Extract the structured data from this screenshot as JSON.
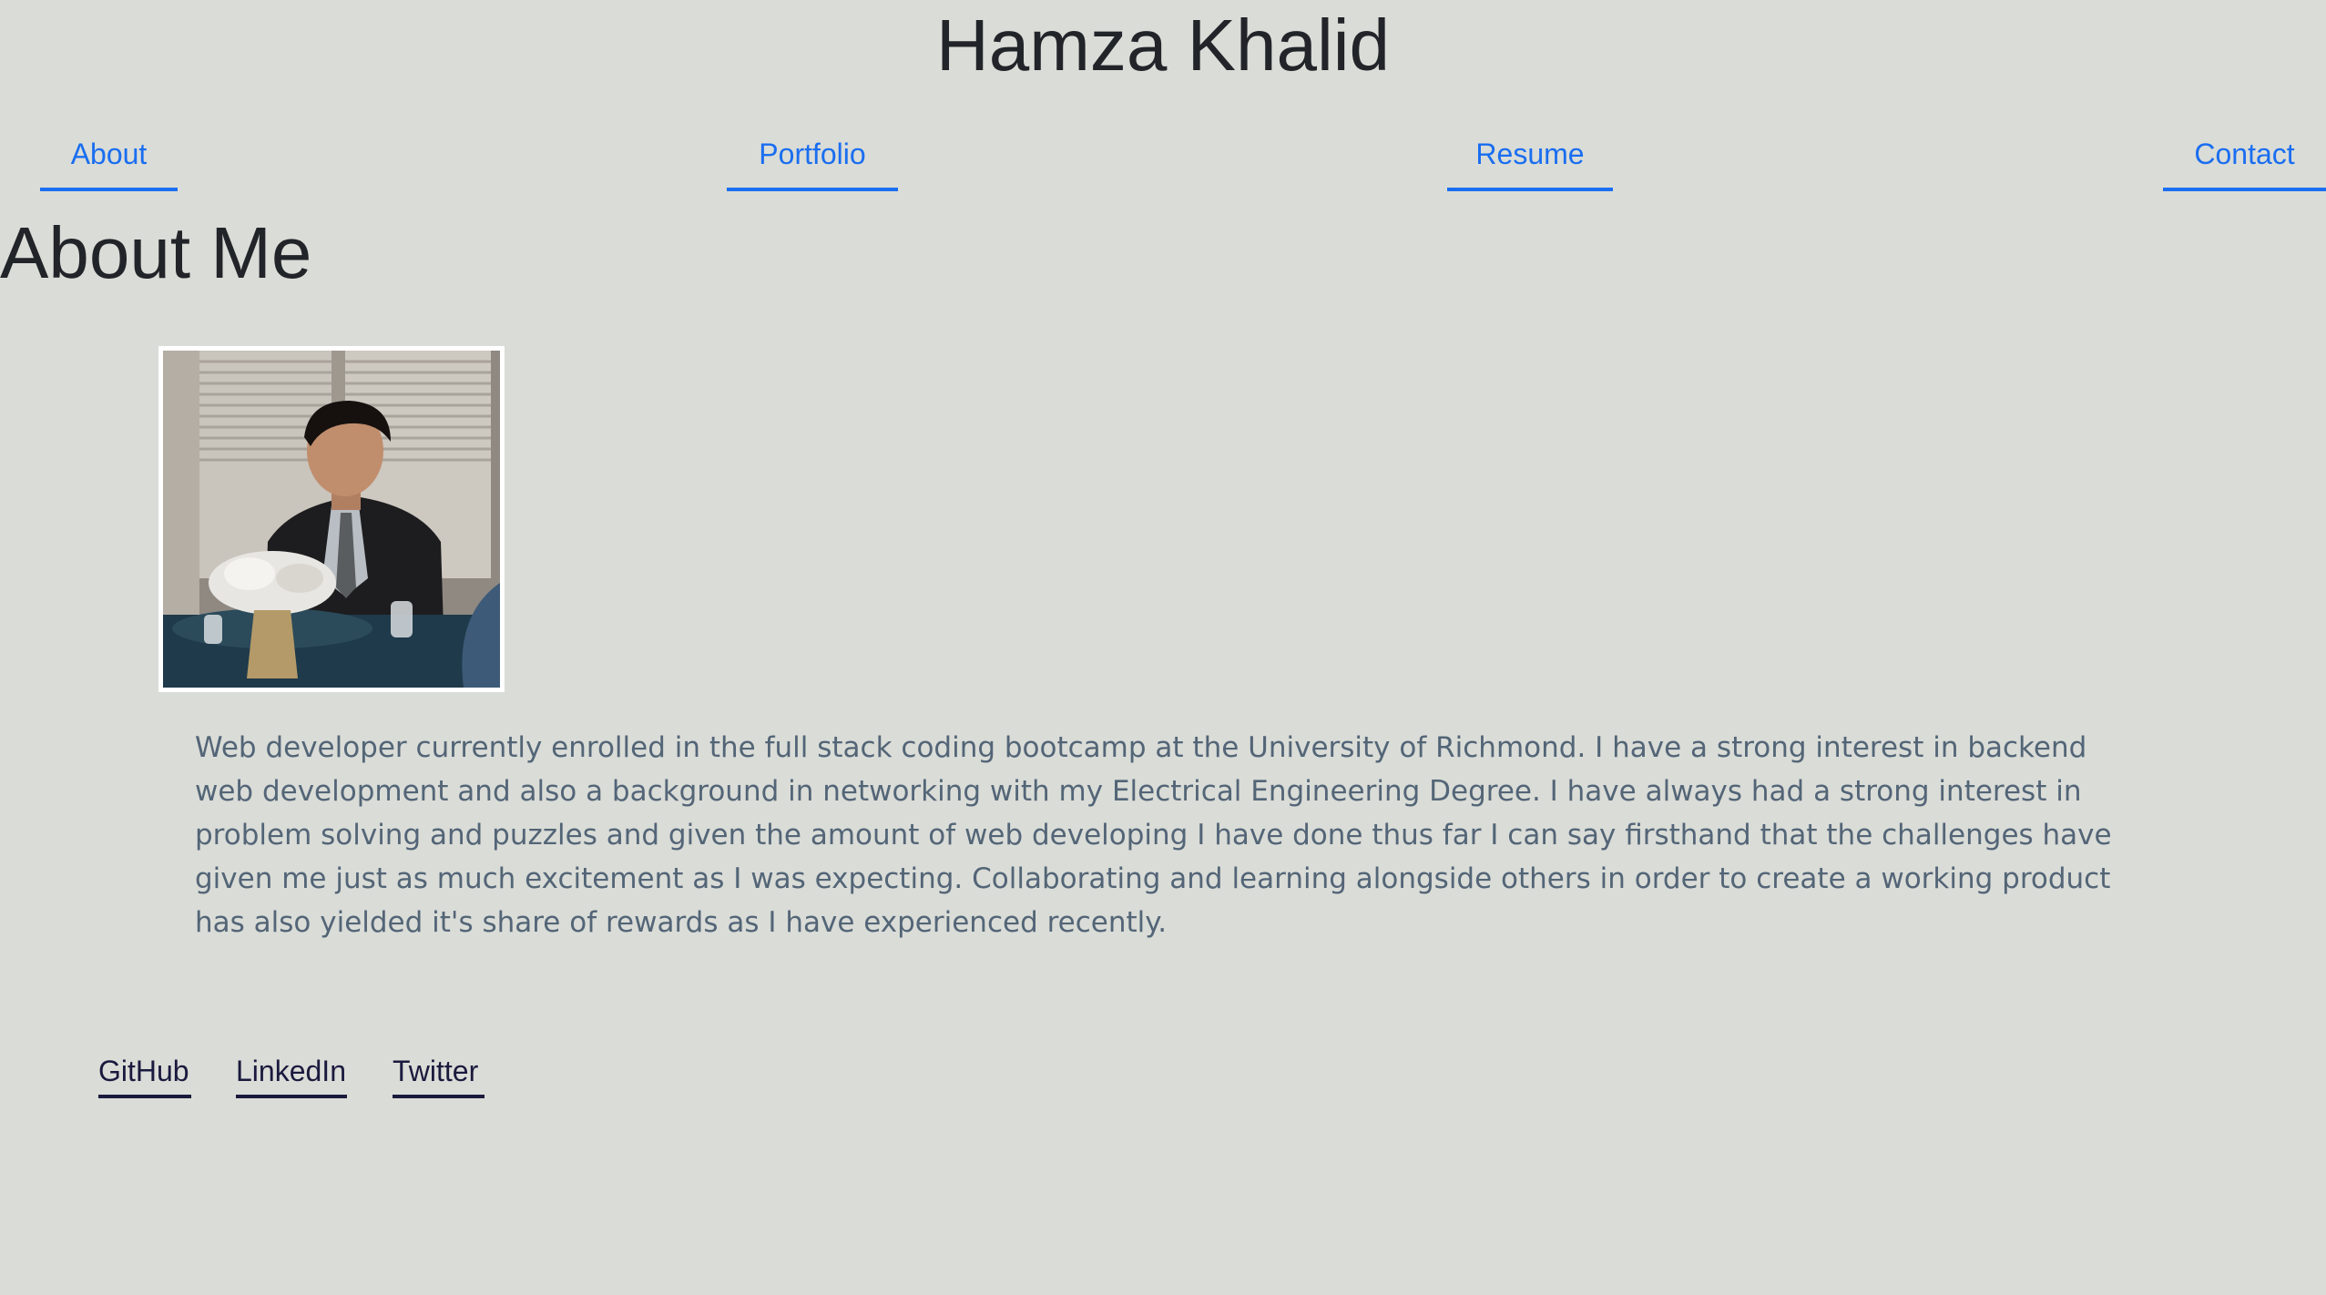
{
  "header": {
    "title": "Hamza Khalid"
  },
  "nav": {
    "items": [
      {
        "label": "About"
      },
      {
        "label": "Portfolio"
      },
      {
        "label": "Resume"
      },
      {
        "label": "Contact"
      }
    ]
  },
  "about": {
    "heading": "About Me",
    "bio": "Web developer currently enrolled in the full stack coding bootcamp at the University of Richmond. I have a strong interest in backend web development and also a background in networking with my Electrical Engineering Degree. I have always had a strong interest in problem solving and puzzles and given the amount of web developing I have done thus far I can say firsthand that the challenges have given me just as much excitement as I was expecting. Collaborating and learning alongside others in order to create a working product has also yielded it's share of rewards as I have experienced recently."
  },
  "footer": {
    "links": [
      {
        "label": "GitHub"
      },
      {
        "label": "LinkedIn"
      },
      {
        "label": "Twitter"
      }
    ]
  },
  "colors": {
    "background": "#dadcd7",
    "nav_link": "#1a6ef0",
    "heading_text": "#212529",
    "bio_text": "#536577",
    "footer_link": "#1a1a3e",
    "photo_border": "#ffffff"
  }
}
